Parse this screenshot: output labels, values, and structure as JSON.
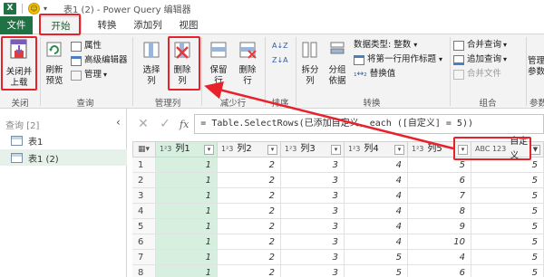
{
  "titlebar": {
    "app_icon": "X",
    "quick_access_icon": "smiley-icon",
    "title": "表1 (2) - Power Query 编辑器"
  },
  "tabs": [
    "文件",
    "开始",
    "转换",
    "添加列",
    "视图"
  ],
  "ribbon": {
    "close": {
      "label1": "关闭并",
      "label2": "上载",
      "group": "关闭"
    },
    "query": {
      "refresh1": "刷新",
      "refresh2": "预览",
      "props": "属性",
      "advanced": "高级编辑器",
      "manage": "管理",
      "group": "查询"
    },
    "manage_cols": {
      "choose1": "选择",
      "choose2": "列",
      "remove1": "删除",
      "remove2": "列",
      "group": "管理列"
    },
    "reduce_rows": {
      "keep1": "保留",
      "keep2": "行",
      "remove1": "删除",
      "remove2": "行",
      "group": "减少行"
    },
    "sort": {
      "group": "排序"
    },
    "transform": {
      "split1": "拆分",
      "split2": "列",
      "groupby1": "分组",
      "groupby2": "依据",
      "datatype": "数据类型: 整数",
      "firstrow": "将第一行用作标题",
      "replace": "替换值",
      "group": "转换"
    },
    "combine": {
      "merge": "合并查询",
      "append": "追加查询",
      "files": "合并文件",
      "group": "组合"
    },
    "params": {
      "label1": "管理",
      "label2": "参数",
      "group": "参数"
    }
  },
  "queries": {
    "header": "查询 [2]",
    "items": [
      "表1",
      "表1 (2)"
    ]
  },
  "formula": "= Table.SelectRows(已添加自定义, each ([自定义] = 5))",
  "table": {
    "columns": [
      {
        "type": "1²3",
        "name": "列1"
      },
      {
        "type": "1²3",
        "name": "列2"
      },
      {
        "type": "1²3",
        "name": "列3"
      },
      {
        "type": "1²3",
        "name": "列4"
      },
      {
        "type": "1²3",
        "name": "列5"
      },
      {
        "type": "ABC 123",
        "name": "自定义"
      }
    ],
    "rows": [
      [
        "1",
        "1",
        "2",
        "3",
        "4",
        "5",
        "5"
      ],
      [
        "2",
        "1",
        "2",
        "3",
        "4",
        "6",
        "5"
      ],
      [
        "3",
        "1",
        "2",
        "3",
        "4",
        "7",
        "5"
      ],
      [
        "4",
        "1",
        "2",
        "3",
        "4",
        "8",
        "5"
      ],
      [
        "5",
        "1",
        "2",
        "3",
        "4",
        "9",
        "5"
      ],
      [
        "6",
        "1",
        "2",
        "3",
        "4",
        "10",
        "5"
      ],
      [
        "7",
        "1",
        "2",
        "3",
        "5",
        "4",
        "5"
      ],
      [
        "8",
        "1",
        "2",
        "3",
        "5",
        "6",
        "5"
      ]
    ]
  },
  "colors": {
    "excel_green": "#1f7244",
    "highlight_red": "#e8222a",
    "selected_col": "#d6efdf"
  }
}
